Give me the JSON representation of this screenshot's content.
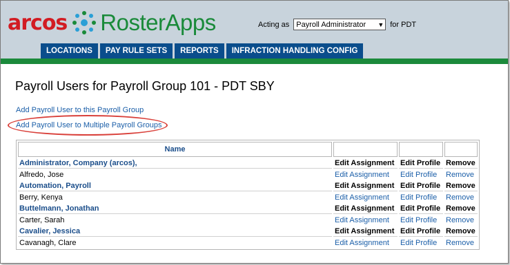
{
  "header": {
    "logo_arcos": "arcos",
    "logo_app": "RosterApps",
    "acting_label": "Acting as",
    "acting_role": "Payroll Administrator",
    "acting_suffix": "for PDT"
  },
  "tabs": [
    "LOCATIONS",
    "PAY RULE SETS",
    "REPORTS",
    "INFRACTION HANDLING CONFIG"
  ],
  "page_title": "Payroll Users for Payroll Group 101 - PDT SBY",
  "links": {
    "add_single": "Add Payroll User to this Payroll Group",
    "add_multiple": "Add Payroll User to Multiple Payroll Groups"
  },
  "table": {
    "headers": [
      "Name",
      "",
      "",
      ""
    ],
    "rows": [
      {
        "name": "Administrator, Company (arcos),",
        "bold": true,
        "assign": "Edit Assignment",
        "profile": "Edit Profile",
        "remove": "Remove"
      },
      {
        "name": "Alfredo, Jose",
        "bold": false,
        "assign": "Edit Assignment",
        "profile": "Edit Profile",
        "remove": "Remove"
      },
      {
        "name": "Automation, Payroll",
        "bold": true,
        "assign": "Edit Assignment",
        "profile": "Edit Profile",
        "remove": "Remove"
      },
      {
        "name": "Berry, Kenya",
        "bold": false,
        "assign": "Edit Assignment",
        "profile": "Edit Profile",
        "remove": "Remove"
      },
      {
        "name": "Buttelmann, Jonathan",
        "bold": true,
        "assign": "Edit Assignment",
        "profile": "Edit Profile",
        "remove": "Remove"
      },
      {
        "name": "Carter, Sarah",
        "bold": false,
        "assign": "Edit Assignment",
        "profile": "Edit Profile",
        "remove": "Remove"
      },
      {
        "name": "Cavalier, Jessica",
        "bold": true,
        "assign": "Edit Assignment",
        "profile": "Edit Profile",
        "remove": "Remove"
      },
      {
        "name": "Cavanagh, Clare",
        "bold": false,
        "assign": "Edit Assignment",
        "profile": "Edit Profile",
        "remove": "Remove"
      }
    ]
  }
}
